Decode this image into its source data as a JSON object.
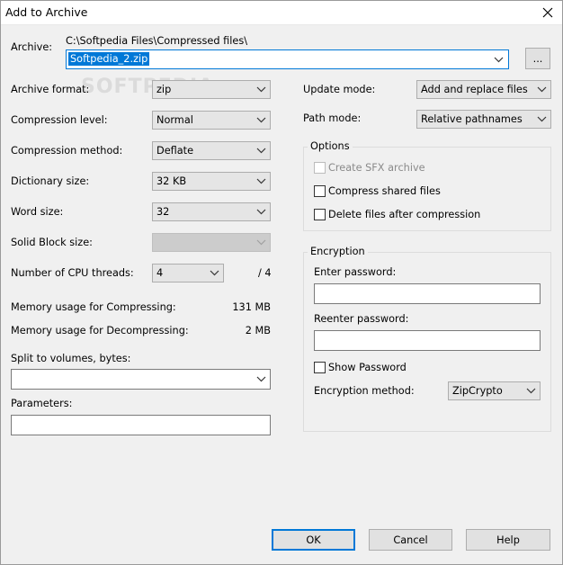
{
  "window": {
    "title": "Add to Archive"
  },
  "archive": {
    "label": "Archive:",
    "path": "C:\\Softpedia Files\\Compressed files\\",
    "filename": "Softpedia_2.zip",
    "browse_label": "..."
  },
  "watermark": "SOFTPEDIA",
  "left": {
    "archive_format": {
      "label": "Archive format:",
      "value": "zip"
    },
    "compression_level": {
      "label": "Compression level:",
      "value": "Normal"
    },
    "compression_method": {
      "label": "Compression method:",
      "value": "Deflate"
    },
    "dictionary_size": {
      "label": "Dictionary size:",
      "value": "32 KB"
    },
    "word_size": {
      "label": "Word size:",
      "value": "32"
    },
    "solid_block_size": {
      "label": "Solid Block size:",
      "value": ""
    },
    "cpu_threads": {
      "label": "Number of CPU threads:",
      "value": "4",
      "max": "/ 4"
    },
    "memory_compress": {
      "label": "Memory usage for Compressing:",
      "value": "131 MB"
    },
    "memory_decompress": {
      "label": "Memory usage for Decompressing:",
      "value": "2 MB"
    },
    "split_volumes": {
      "label": "Split to volumes, bytes:",
      "value": ""
    },
    "parameters": {
      "label": "Parameters:",
      "value": ""
    }
  },
  "right": {
    "update_mode": {
      "label": "Update mode:",
      "value": "Add and replace files"
    },
    "path_mode": {
      "label": "Path mode:",
      "value": "Relative pathnames"
    },
    "options": {
      "title": "Options",
      "create_sfx": {
        "label": "Create SFX archive",
        "checked": false,
        "enabled": false
      },
      "compress_shared": {
        "label": "Compress shared files",
        "checked": false
      },
      "delete_after": {
        "label": "Delete files after compression",
        "checked": false
      }
    },
    "encryption": {
      "title": "Encryption",
      "enter_password_label": "Enter password:",
      "reenter_password_label": "Reenter password:",
      "show_password_label": "Show Password",
      "method_label": "Encryption method:",
      "method_value": "ZipCrypto"
    }
  },
  "buttons": {
    "ok": "OK",
    "cancel": "Cancel",
    "help": "Help"
  },
  "colors": {
    "accent": "#0078d7",
    "background": "#f0f0f0",
    "button": "#e1e1e1"
  }
}
